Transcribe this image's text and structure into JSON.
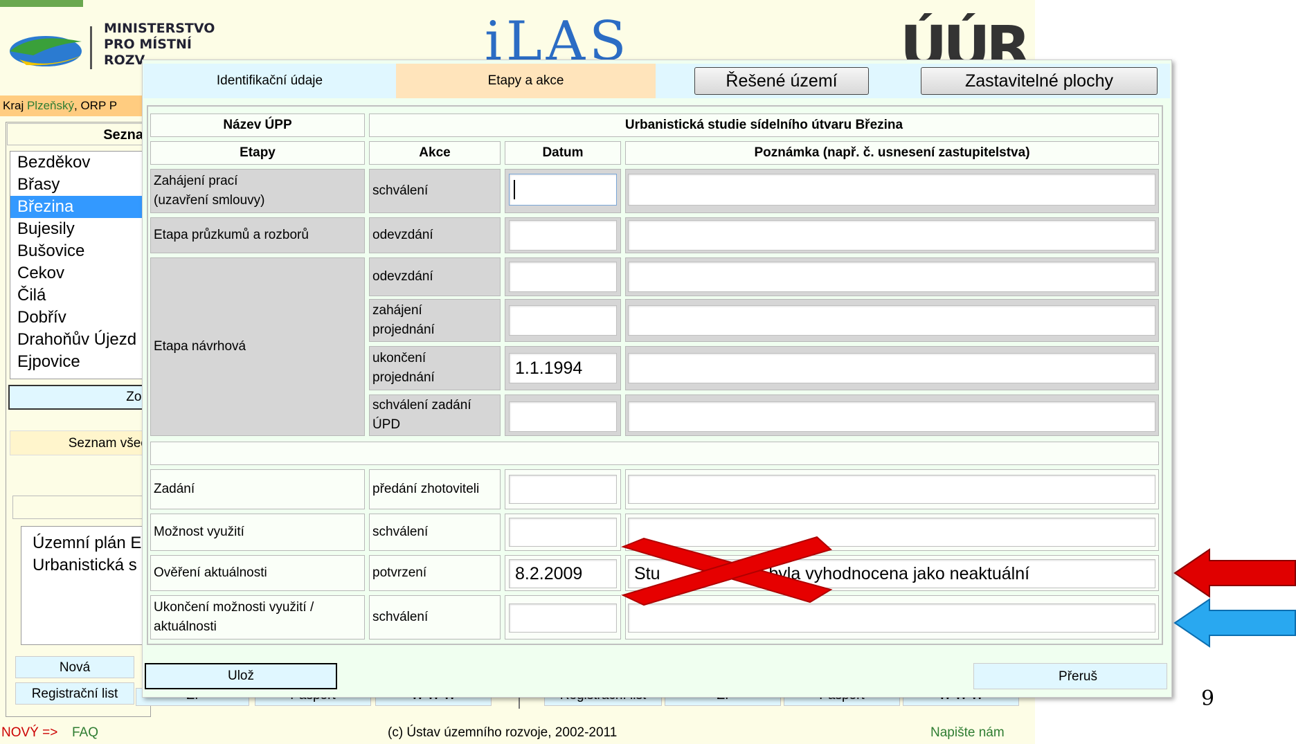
{
  "app": {
    "ministry": "MINISTERSTVO\nPRO MÍSTNÍ\nROZV",
    "title": "iLAS",
    "uur": "ÚÚR",
    "region_kraj": "Kraj ",
    "region_name": "Plzeňský",
    "region_orp": ", ORP P"
  },
  "left": {
    "list_header": "Sezna",
    "towns": [
      "Bezděkov",
      "Břasy",
      "Březina",
      "Bujesily",
      "Bušovice",
      "Cekov",
      "Čilá",
      "Dobřív",
      "Drahoňův Újezd",
      "Ejpovice"
    ],
    "selected_town": "Březina",
    "show_button": "Zob",
    "list_all_button": "Seznam všecl",
    "plans": [
      "Územní plán E",
      "Urbanistická s"
    ]
  },
  "bottom_buttons": {
    "new": "Nová",
    "reg_list": "Registrační list",
    "row1": [
      "Nová"
    ],
    "row2": [
      "Registrační list",
      "Z.",
      "Pasport",
      "W W W",
      "Registrační list",
      "Z.",
      "Pasport",
      "W W W"
    ]
  },
  "footer": {
    "new": "NOVÝ =>",
    "faq": "FAQ",
    "copyright": "(c) Ústav územního rozvoje, 2002-2011",
    "write_us": "Napište nám"
  },
  "page_number": "9",
  "dialog": {
    "tabs": {
      "identification": "Identifikační údaje",
      "stages": "Etapy a akce",
      "area": "Řešené území",
      "buildable": "Zastavitelné plochy"
    },
    "name_label": "Název ÚPP",
    "name_value": "Urbanistická studie sídelního útvaru Březina",
    "headers": {
      "stages": "Etapy",
      "actions": "Akce",
      "date": "Datum",
      "note": "Poznámka (např. č. usnesení zastupitelstva)"
    },
    "stages": {
      "start": "Zahájení prací\n(uzavření smlouvy)",
      "survey": "Etapa průzkumů a rozborů",
      "design": "Etapa návrhová",
      "assignment": "Zadání",
      "use": "Možnost využití",
      "verify": "Ověření aktuálnosti",
      "end": "Ukončení možnosti využití /\naktuálnosti"
    },
    "actions": {
      "approval": "schválení",
      "handover": "odevzdání",
      "handover2": "odevzdání",
      "discussion_start": "zahájení\nprojednání",
      "discussion_end": "ukončení\nprojednání",
      "approval_assignment": "schválení zadání\nÚPD",
      "to_contractor": "předání zhotoviteli",
      "approval_use": "schválení",
      "confirmation": "potvrzení",
      "approval_end": "schválení"
    },
    "dates": {
      "discussion_end": "1.1.1994",
      "confirmation": "8.2.2009"
    },
    "notes": {
      "confirmation": "Studie byla vyhodnocena jako neaktuální",
      "confirmation_visible": "Stu",
      "confirmation_visible_tail": "a byla vyhodnocena jako neaktuální"
    },
    "save": "Ulož",
    "stop": "Přeruš"
  },
  "colors": {
    "red_arrow": "#e00000",
    "blue_arrow": "#29a8f0",
    "cross": "#e60000"
  }
}
